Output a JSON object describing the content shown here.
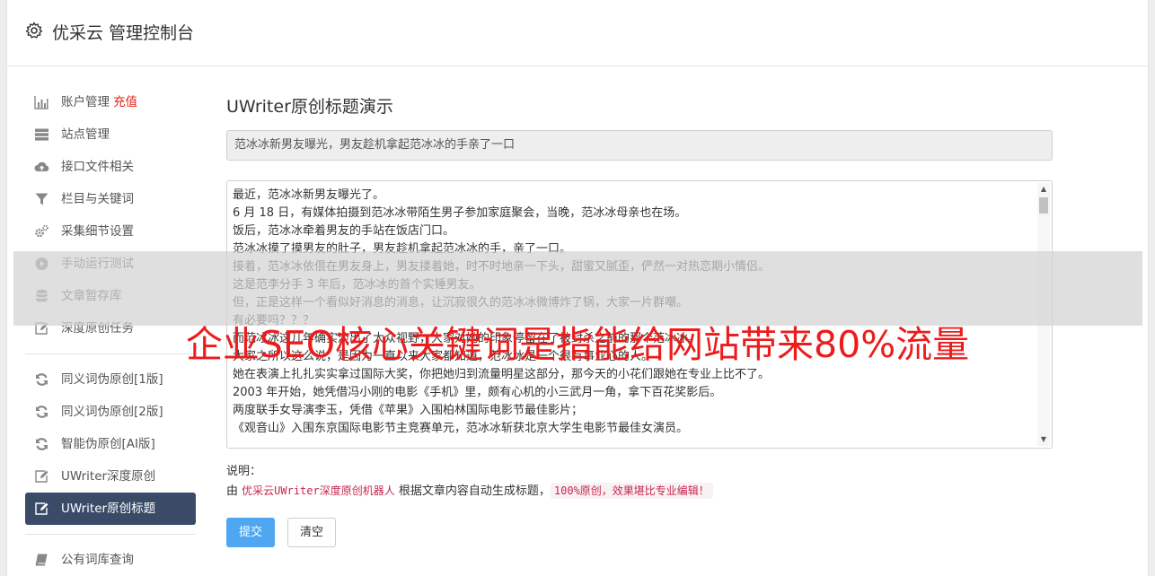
{
  "header": {
    "title": "优采云 管理控制台"
  },
  "sidebar": {
    "group1": [
      {
        "label": "账户管理",
        "badge": "充值",
        "icon": "bar-chart-icon"
      },
      {
        "label": "站点管理",
        "icon": "server-icon"
      },
      {
        "label": "接口文件相关",
        "icon": "cloud-upload-icon"
      },
      {
        "label": "栏目与关键词",
        "icon": "filter-icon"
      },
      {
        "label": "采集细节设置",
        "icon": "cogs-icon"
      },
      {
        "label": "手动运行测试",
        "icon": "play-circle-icon"
      },
      {
        "label": "文章暂存库",
        "icon": "database-icon"
      },
      {
        "label": "深度原创任务",
        "icon": "edit-icon"
      }
    ],
    "group2": [
      {
        "label": "同义词伪原创[1版]",
        "icon": "refresh-icon"
      },
      {
        "label": "同义词伪原创[2版]",
        "icon": "refresh-icon"
      },
      {
        "label": "智能伪原创[AI版]",
        "icon": "refresh-icon"
      },
      {
        "label": "UWriter深度原创",
        "icon": "edit-icon"
      },
      {
        "label": "UWriter原创标题",
        "icon": "edit-icon",
        "active": true
      }
    ],
    "group3": [
      {
        "label": "公有词库查询",
        "icon": "book-icon"
      }
    ]
  },
  "main": {
    "section_title": "UWriter原创标题演示",
    "title_value": "范冰冰新男友曝光，男友趁机拿起范冰冰的手亲了一口",
    "article_lines": [
      "最近，范冰冰新男友曝光了。",
      "6 月 18 日，有媒体拍摄到范冰冰带陌生男子参加家庭聚会，当晚，范冰冰母亲也在场。",
      "饭后，范冰冰牵着男友的手站在饭店门口。",
      "范冰冰摸了摸男友的肚子，男友趁机拿起范冰冰的手，亲了一口。",
      "接着，范冰冰依偎在男友身上，男友搂着她，时不时地亲一下头，甜蜜又腻歪，俨然一对热恋期小情侣。",
      "这是范李分手 3 年后，范冰冰的首个实锤男友。",
      "但，正是这样一个看似好消息的消息，让沉寂很久的范冰冰微博炸了锅，大家一片群嘲。",
      "有必要吗？？？",
      "而范冰冰这几年确实淡出了大众视野，大家对她的印象停留在了被封杀之前的那个范冰冰。",
      "大家之所以这么说，是因为一直以来大家都知道，范冰冰是一个很有事业心的人。",
      "她在表演上扎扎实实拿过国际大奖，你把她归到流量明星这部分，那今天的小花们跟她在专业上比不了。",
      "2003 年开始，她凭借冯小刚的电影《手机》里，颇有心机的小三武月一角，拿下百花奖影后。",
      "两度联手女导演李玉，凭借《苹果》入围柏林国际电影节最佳影片；",
      "《观音山》入围东京国际电影节主竞赛单元，范冰冰斩获北京大学生电影节最佳女演员。"
    ],
    "explain_label": "说明：",
    "desc_prefix": "由",
    "desc_code": "优采云UWriter深度原创机器人",
    "desc_middle": "根据文章内容自动生成标题，",
    "desc_pill": "100%原创，效果堪比专业编辑！",
    "submit_label": "提交",
    "clear_label": "清空"
  },
  "watermark": "企业SEO核心关键词是指能给网站带来80%流量",
  "colors": {
    "active_nav": "#3a4b68",
    "primary_button": "#4ea7f0",
    "badge": "#e2231a",
    "watermark": "#ec1c1c"
  }
}
